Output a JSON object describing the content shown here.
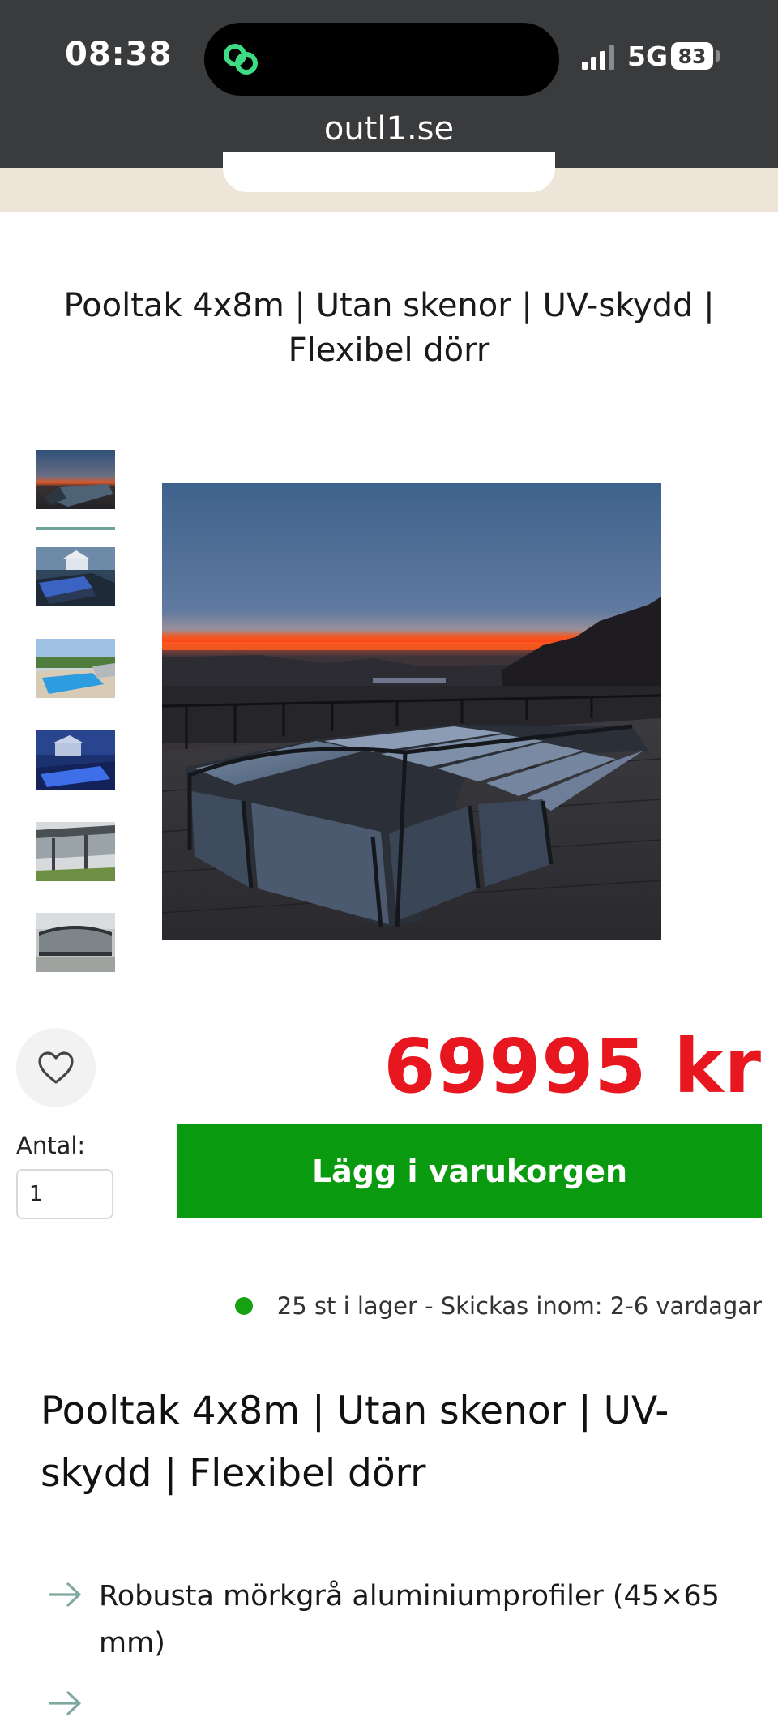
{
  "status_bar": {
    "time": "08:38",
    "network": "5G",
    "battery": "83"
  },
  "browser": {
    "url": "outl1.se"
  },
  "product": {
    "title": "Pooltak 4x8m | Utan skenor | UV-skydd | Flexibel dörr",
    "price": "69995 kr",
    "quantity_label": "Antal:",
    "quantity_value": "1",
    "add_to_cart_label": "Lägg i varukorgen",
    "stock_text": "25 st i lager - Skickas inom: 2-6 vardagar"
  },
  "gallery": {
    "selected_index": 0,
    "thumbnail_count": 6
  },
  "description": {
    "title": "Pooltak 4x8m | Utan skenor | UV-skydd | Flexibel dörr",
    "bullets": [
      "Robusta mörkgrå aluminiumprofiler (45×65 mm)"
    ]
  },
  "colors": {
    "price": "#e8161e",
    "add_to_cart": "#0a9a0f",
    "stock_dot": "#16a112",
    "top_bar": "#3a3b3d",
    "cream_strip": "#eee5d8"
  },
  "icons": {
    "island": "link-app-icon",
    "signal": "cellular-signal-icon",
    "favorite": "heart-icon",
    "bullet": "arrow-right-icon"
  }
}
